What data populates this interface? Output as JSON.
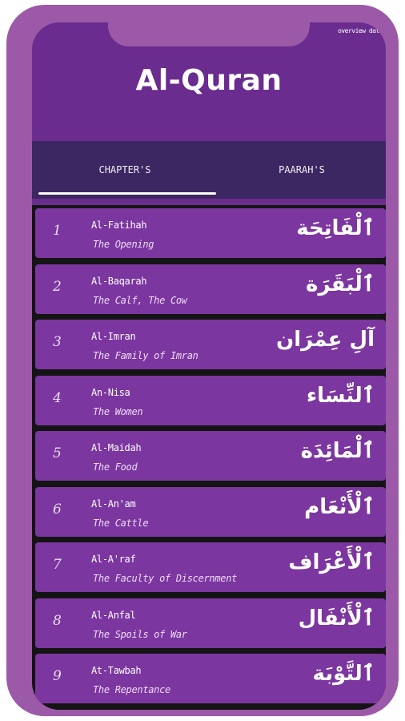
{
  "header": {
    "title": "Al-Quran",
    "status_text": "overview data"
  },
  "tabs": [
    {
      "label": "CHAPTER'S",
      "selected": true
    },
    {
      "label": "PAARAH'S",
      "selected": false
    }
  ],
  "chapters": [
    {
      "number": "1",
      "name": "Al-Fatihah",
      "meaning": "The Opening",
      "arabic": "ٱلْفَاتِحَة"
    },
    {
      "number": "2",
      "name": "Al-Baqarah",
      "meaning": "The Calf, The Cow",
      "arabic": "ٱلْبَقَرَة"
    },
    {
      "number": "3",
      "name": "Al-Imran",
      "meaning": "The Family of Imran",
      "arabic": "آلِ عِمْرَان"
    },
    {
      "number": "4",
      "name": "An-Nisa",
      "meaning": "The Women",
      "arabic": "ٱلنِّسَاء"
    },
    {
      "number": "5",
      "name": "Al-Maidah",
      "meaning": "The Food",
      "arabic": "ٱلْمَائِدَة"
    },
    {
      "number": "6",
      "name": "Al-An'am",
      "meaning": "The Cattle",
      "arabic": "ٱلْأَنْعَام"
    },
    {
      "number": "7",
      "name": "Al-A'raf",
      "meaning": "The Faculty of Discernment",
      "arabic": "ٱلْأَعْرَاف"
    },
    {
      "number": "8",
      "name": "Al-Anfal",
      "meaning": "The Spoils of War",
      "arabic": "ٱلْأَنْفَال"
    },
    {
      "number": "9",
      "name": "At-Tawbah",
      "meaning": "The Repentance",
      "arabic": "ٱلتَّوْبَة"
    }
  ],
  "colors": {
    "frame": "#9b59a8",
    "screen": "#6a2c8e",
    "tab_bar": "#3c2762",
    "row": "#7c36a0"
  }
}
